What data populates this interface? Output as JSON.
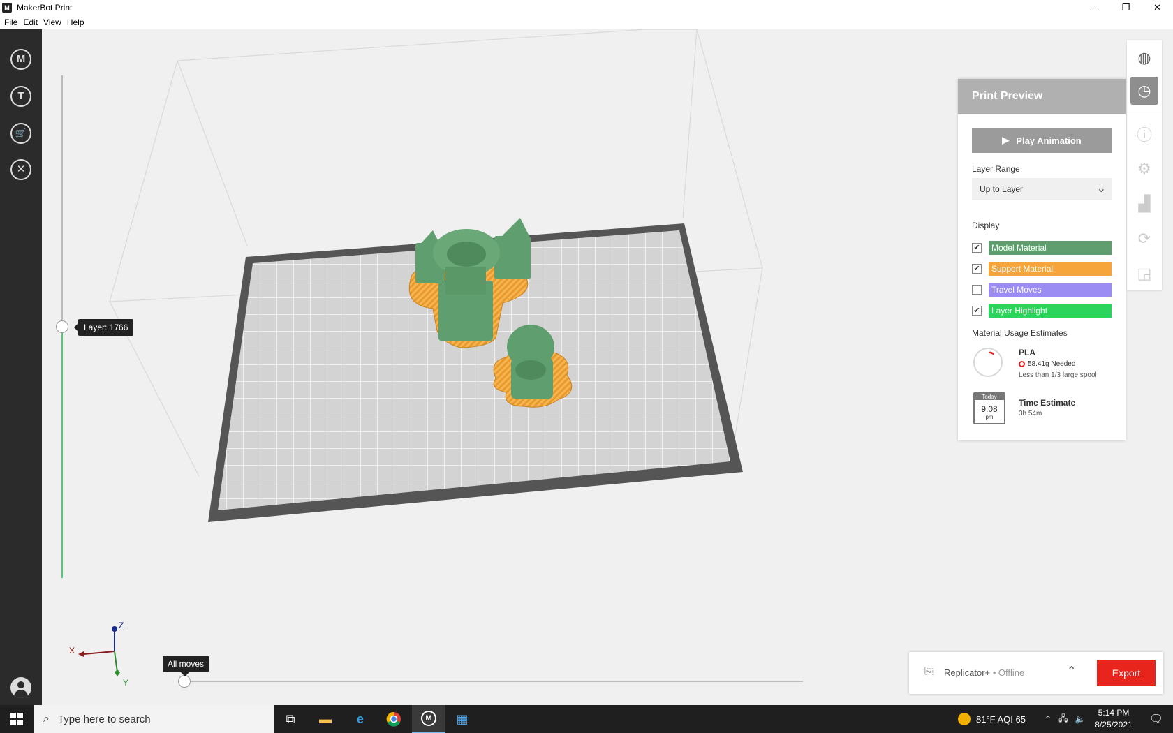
{
  "window": {
    "title": "MakerBot Print",
    "controls": [
      "—",
      "❐",
      "✕"
    ]
  },
  "menu": [
    "File",
    "Edit",
    "View",
    "Help"
  ],
  "left_nav": [
    {
      "name": "makerbot-logo-icon",
      "glyph": "M"
    },
    {
      "name": "thingiverse-icon",
      "glyph": "T"
    },
    {
      "name": "cart-icon",
      "glyph": "🛒"
    },
    {
      "name": "tools-icon",
      "glyph": "✕"
    }
  ],
  "viewport": {
    "layer_label": "Layer: 1766",
    "moves_label": "All moves",
    "axes": {
      "x": "X",
      "y": "Y",
      "z": "Z"
    }
  },
  "print_preview": {
    "title": "Print Preview",
    "play_button": "Play Animation",
    "layer_range_label": "Layer Range",
    "layer_range_value": "Up to Layer",
    "display_label": "Display",
    "display_items": [
      {
        "label": "Model Material",
        "checked": true,
        "color": "#5f9e6e"
      },
      {
        "label": "Support Material",
        "checked": true,
        "color": "#f5a53a"
      },
      {
        "label": "Travel Moves",
        "checked": false,
        "color": "#9a8cf2"
      },
      {
        "label": "Layer Highlight",
        "checked": true,
        "color": "#2dd45c"
      }
    ],
    "material_heading": "Material Usage Estimates",
    "material": {
      "name": "PLA",
      "needed": "58.41g  Needed",
      "spool": "Less than 1/3 large spool"
    },
    "calendar": {
      "top": "Today",
      "time": "9:08",
      "ampm": "pm"
    },
    "time_estimate_label": "Time Estimate",
    "time_estimate_value": "3h 54m"
  },
  "export_bar": {
    "printer": "Replicator+",
    "status": " • Offline",
    "export_label": "Export"
  },
  "taskbar": {
    "search_placeholder": "Type here to search",
    "weather": "81°F  AQI 65",
    "time": "5:14 PM",
    "date": "8/25/2021"
  }
}
